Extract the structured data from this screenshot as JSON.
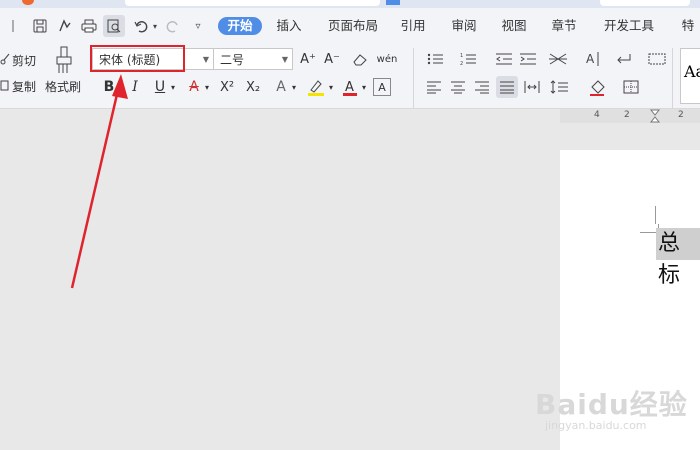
{
  "menu_tabs": [
    "开始",
    "插入",
    "页面布局",
    "引用",
    "审阅",
    "视图",
    "章节",
    "开发工具",
    "特色"
  ],
  "clipboard": {
    "cut_label": "剪切",
    "copy_label": "复制",
    "format_painter_label": "格式刷"
  },
  "font": {
    "family": "宋体 (标题)",
    "size": "二号"
  },
  "format_glyphs": {
    "bold": "B",
    "italic": "I",
    "underline": "U",
    "strike": "A",
    "superscript": "X²",
    "subscript": "X₂",
    "text_effect": "A",
    "highlight": "A",
    "font_color": "A",
    "char_border": "A",
    "grow": "A⁺",
    "shrink": "A⁻",
    "phonetic": "wén"
  },
  "style_preview": "Aa",
  "ruler": {
    "marks": [
      "4",
      "2",
      "2"
    ]
  },
  "document": {
    "title_text": "总标"
  },
  "watermark": {
    "logo": "Baidu经验",
    "url": "jingyan.baidu.com"
  },
  "colors": {
    "accent": "#4f8de6",
    "annotation": "#e0242d",
    "selection": "#cfcfcf",
    "highlight_yellow": "#f5e400",
    "font_red": "#e0242d"
  }
}
